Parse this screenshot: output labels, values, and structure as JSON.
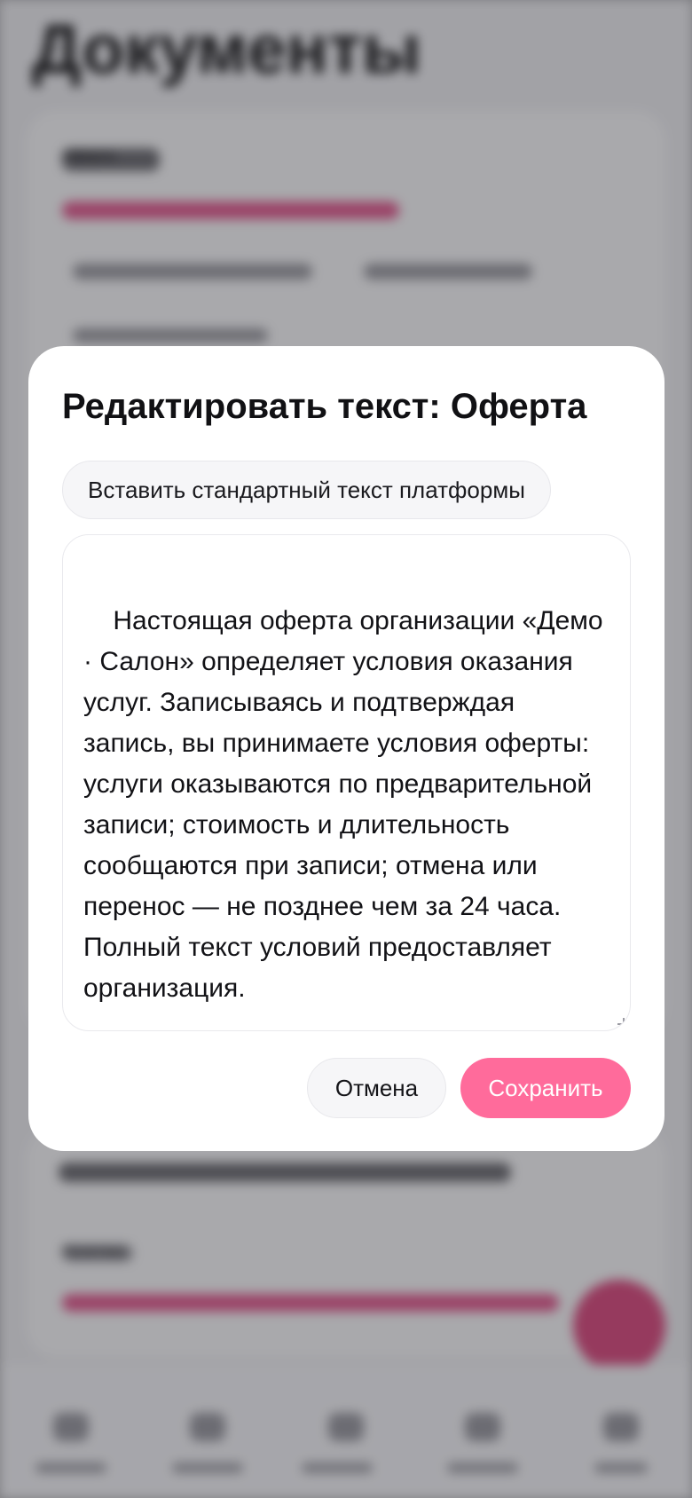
{
  "background": {
    "page_title": "Документы",
    "card1_label": "Оферта",
    "card2_label": "Политика"
  },
  "dialog": {
    "title": "Редактировать текст: Оферта",
    "insert_default_label": "Вставить стандартный текст платформы",
    "text_value": "Настоящая оферта организации «Демо · Салон» определяет условия оказания услуг. Записываясь и подтверждая запись, вы принимаете условия оферты: услуги оказываются по предварительной записи; стоимость и длительность сообщаются при записи; отмена или перенос — не позднее чем за 24 часа. Полный текст условий предоставляет организация.",
    "cancel_label": "Отмена",
    "save_label": "Сохранить"
  },
  "colors": {
    "accent": "#ff6b9b",
    "overlay": "rgba(40,40,48,0.40)"
  }
}
